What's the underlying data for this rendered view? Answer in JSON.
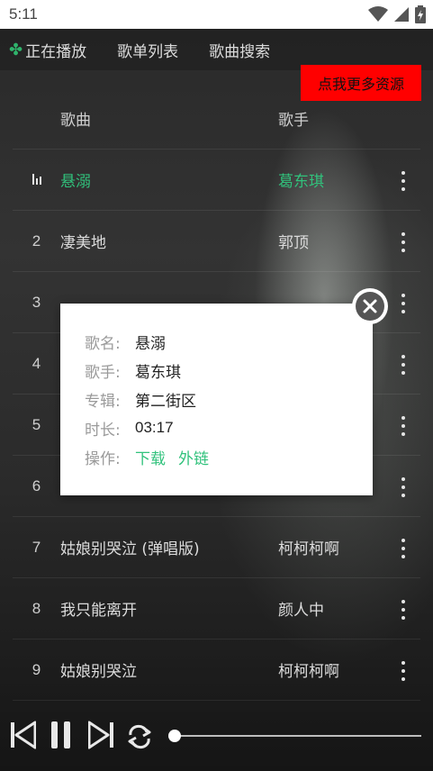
{
  "status_bar": {
    "time": "5:11",
    "icons": [
      "wifi-icon",
      "signal-icon",
      "battery-icon"
    ]
  },
  "nav": {
    "tabs": [
      {
        "label": "正在播放",
        "icon": "clover-icon"
      },
      {
        "label": "歌单列表"
      },
      {
        "label": "歌曲搜索"
      }
    ]
  },
  "promo": {
    "label": "点我更多资源"
  },
  "list": {
    "header": {
      "song": "歌曲",
      "artist": "歌手"
    },
    "rows": [
      {
        "num": "",
        "song": "悬溺",
        "artist": "葛东琪",
        "active": true
      },
      {
        "num": "2",
        "song": "凄美地",
        "artist": "郭顶"
      },
      {
        "num": "3",
        "song": "",
        "artist": ""
      },
      {
        "num": "4",
        "song": "",
        "artist": ""
      },
      {
        "num": "5",
        "song": "",
        "artist": ""
      },
      {
        "num": "6",
        "song": "",
        "artist": ""
      },
      {
        "num": "7",
        "song": "姑娘别哭泣 (弹唱版)",
        "artist": "柯柯柯啊"
      },
      {
        "num": "8",
        "song": "我只能离开",
        "artist": "颜人中"
      },
      {
        "num": "9",
        "song": "姑娘别哭泣",
        "artist": "柯柯柯啊"
      }
    ]
  },
  "modal": {
    "name_label": "歌名:",
    "name_value": "悬溺",
    "artist_label": "歌手:",
    "artist_value": "葛东琪",
    "album_label": "专辑:",
    "album_value": "第二街区",
    "duration_label": "时长:",
    "duration_value": "03:17",
    "actions_label": "操作:",
    "download_label": "下载",
    "link_label": "外链"
  },
  "player": {
    "progress": 0.0,
    "colors": {
      "accent": "#31c27c",
      "promo": "#ff0000"
    }
  }
}
